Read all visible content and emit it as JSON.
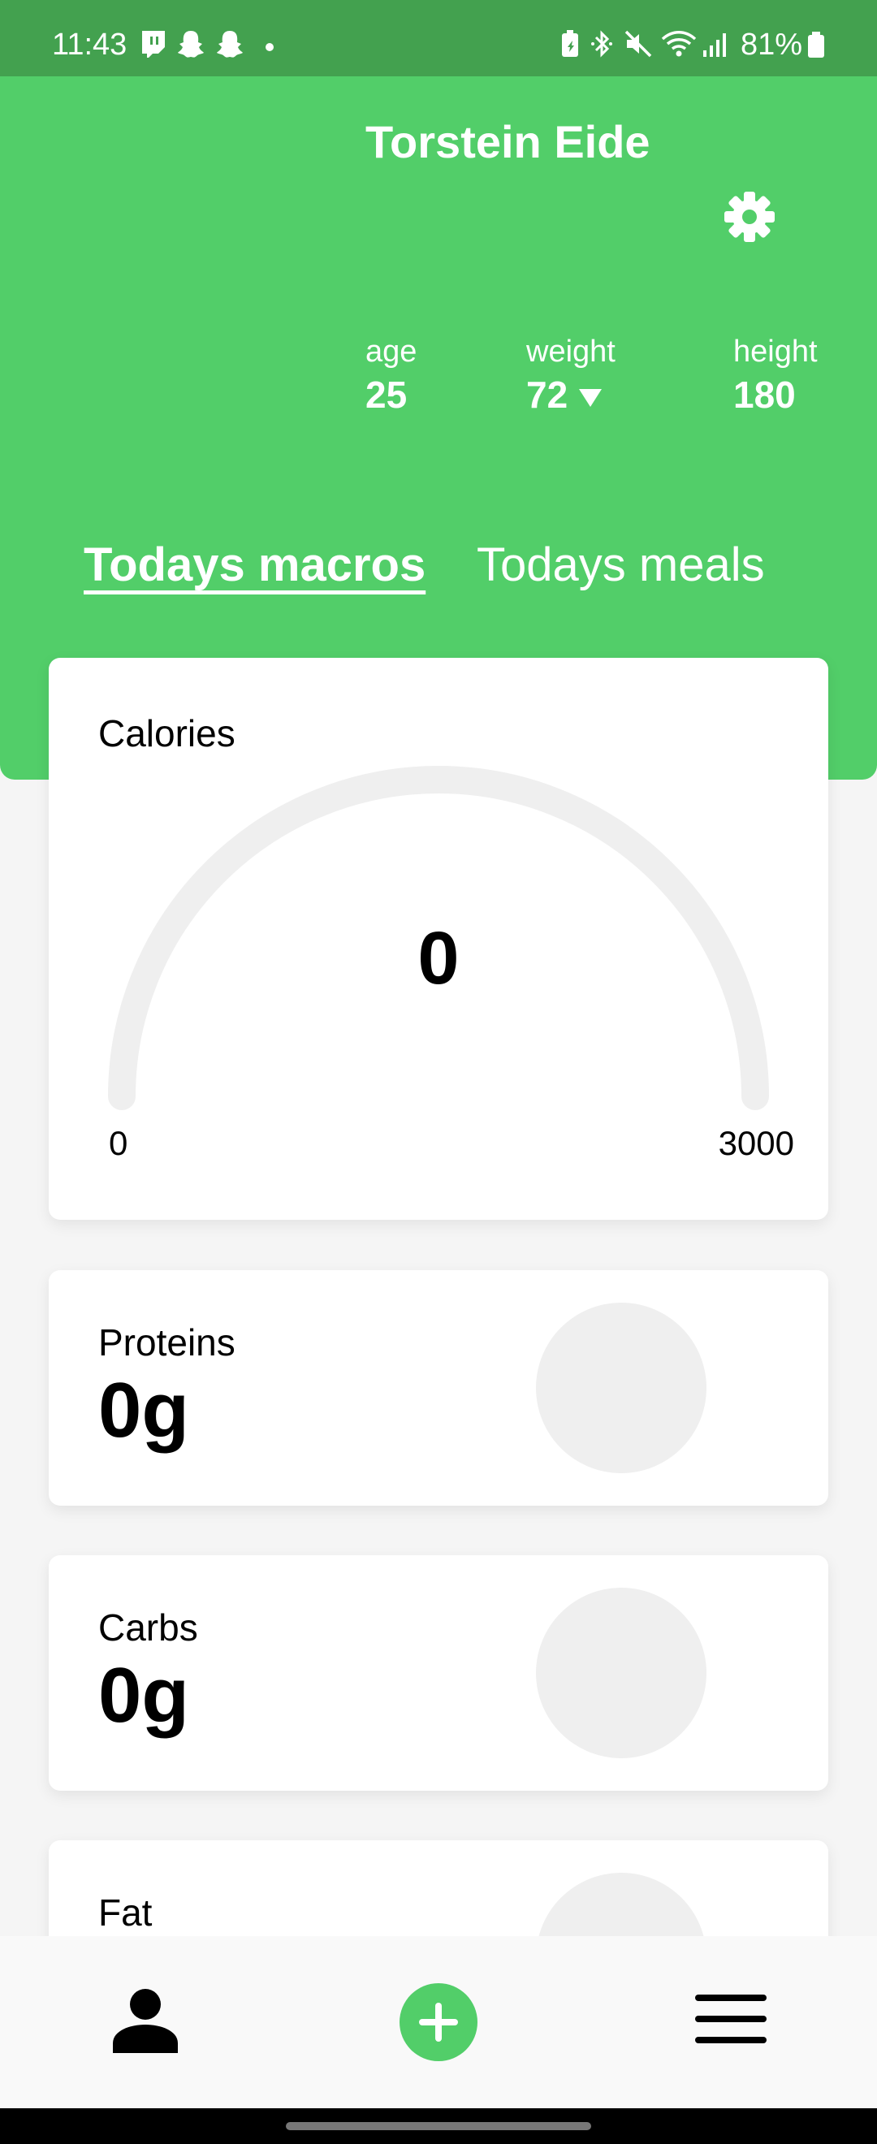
{
  "status_bar": {
    "time": "11:43",
    "battery": "81%",
    "icons": [
      "twitch-icon",
      "snapchat-icon",
      "snapchat-icon",
      "dot-icon",
      "battery-saver-icon",
      "bluetooth-icon",
      "mute-icon",
      "wifi-icon",
      "signal-icon",
      "battery-icon"
    ]
  },
  "profile": {
    "name": "Torstein Eide",
    "stats": {
      "age": {
        "label": "age",
        "value": "25"
      },
      "weight": {
        "label": "weight",
        "value": "72"
      },
      "height": {
        "label": "height",
        "value": "180"
      }
    }
  },
  "tabs": [
    {
      "label": "Todays macros",
      "active": true
    },
    {
      "label": "Todays meals",
      "active": false
    }
  ],
  "calories": {
    "label": "Calories",
    "value": "0",
    "min": "0",
    "max": "3000",
    "progress": 0
  },
  "macros": [
    {
      "label": "Proteins",
      "value": "0g"
    },
    {
      "label": "Carbs",
      "value": "0g"
    },
    {
      "label": "Fat",
      "value": ""
    }
  ],
  "bottom_nav": {
    "items": [
      "profile-icon",
      "add-icon",
      "menu-icon"
    ]
  },
  "colors": {
    "header_green": "#52ce69",
    "status_green": "#43a14f",
    "gauge_track": "#efefef"
  }
}
